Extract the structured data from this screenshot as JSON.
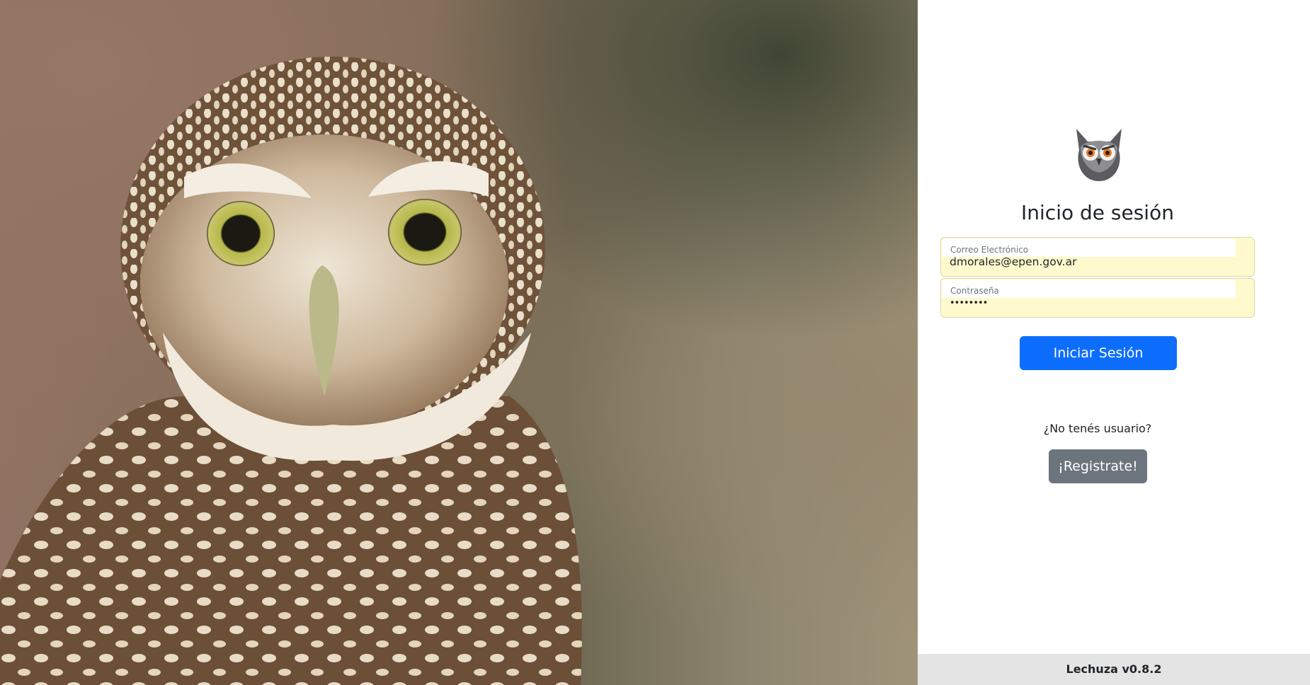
{
  "login": {
    "title": "Inicio de sesión",
    "email_label": "Correo Electrónico",
    "email_value": "dmorales@epen.gov.ar",
    "password_label": "Contraseña",
    "password_value": "••••••••",
    "submit_label": "Iniciar Sesión",
    "no_user_text": "¿No tenés usuario?",
    "register_label": "¡Registrate!"
  },
  "footer": {
    "version": "Lechuza v0.8.2"
  },
  "colors": {
    "primary_button": "#0d6efd",
    "secondary_button": "#6c757d",
    "autofill_background": "#fffacd",
    "footer_background": "#e4e4e4"
  },
  "icons": {
    "logo": "owl-logo-icon"
  },
  "background_image": "owl-photo"
}
